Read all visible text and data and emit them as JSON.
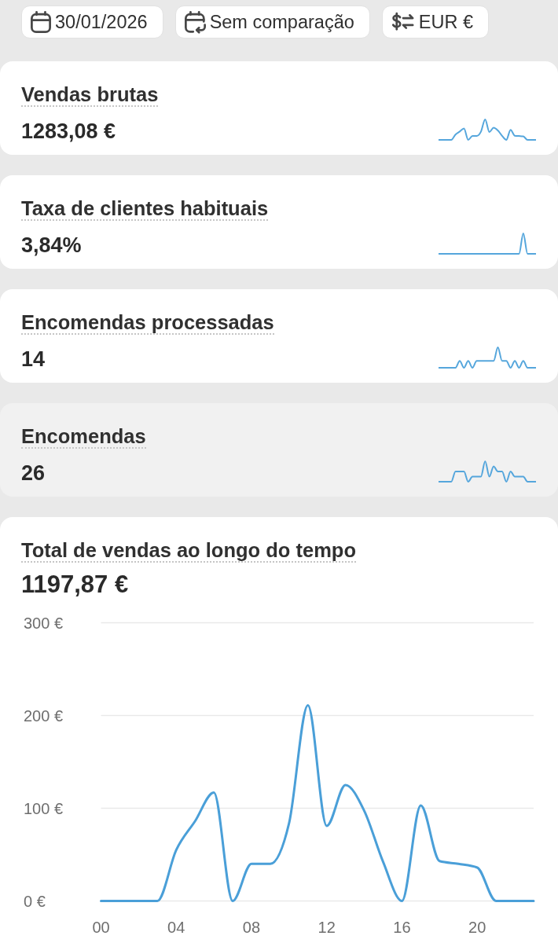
{
  "filters": [
    {
      "kind": "date",
      "label": "30/01/2026"
    },
    {
      "kind": "comparison",
      "label": "Sem comparação"
    },
    {
      "kind": "currency",
      "label": "EUR €"
    }
  ],
  "metrics": [
    {
      "title": "Vendas brutas",
      "value": "1283,08 €",
      "highlighted": false
    },
    {
      "title": "Taxa de clientes habituais",
      "value": "3,84%",
      "highlighted": false
    },
    {
      "title": "Encomendas processadas",
      "value": "14",
      "highlighted": false
    },
    {
      "title": "Encomendas",
      "value": "26",
      "highlighted": true
    }
  ],
  "sales_chart": {
    "title": "Total de vendas ao longo do tempo",
    "value": "1197,87 €",
    "chart_data": {
      "type": "line",
      "x": [
        0,
        1,
        2,
        3,
        4,
        5,
        6,
        7,
        8,
        9,
        10,
        11,
        12,
        13,
        14,
        15,
        16,
        17,
        18,
        19,
        20,
        21,
        22,
        23
      ],
      "series": [
        {
          "color": "#4a9fd8",
          "values": [
            0,
            0,
            0,
            0,
            55,
            86,
            117,
            0,
            40,
            40,
            84,
            211,
            81,
            125,
            97,
            42,
            0,
            103,
            43,
            40,
            36,
            0,
            0,
            0
          ]
        }
      ],
      "xlim": [
        0,
        23
      ],
      "ylim": [
        0,
        300
      ],
      "yticks": [
        {
          "value": 0,
          "label": "0 €"
        },
        {
          "value": 100,
          "label": "100 €"
        },
        {
          "value": 200,
          "label": "200 €"
        },
        {
          "value": 300,
          "label": "300 €"
        }
      ],
      "xticks": [
        {
          "value": 0,
          "label": "00"
        },
        {
          "value": 4,
          "label": "04"
        },
        {
          "value": 8,
          "label": "08"
        },
        {
          "value": 12,
          "label": "12"
        },
        {
          "value": 16,
          "label": "16"
        },
        {
          "value": 20,
          "label": "20"
        }
      ]
    }
  }
}
